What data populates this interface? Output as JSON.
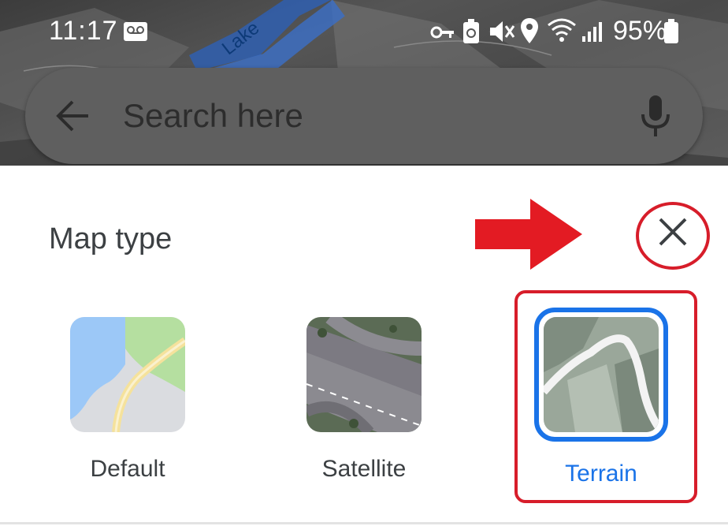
{
  "status_bar": {
    "time": "11:17",
    "battery_percent": "95%",
    "icons": [
      "voicemail-icon",
      "vpn-key-icon",
      "battery-saver-icon",
      "mute-icon",
      "location-icon",
      "wifi-icon",
      "signal-icon",
      "battery-icon"
    ]
  },
  "map": {
    "label": "Lake"
  },
  "search": {
    "placeholder": "Search here",
    "value": ""
  },
  "sheet": {
    "title": "Map type",
    "options": [
      {
        "label": "Default",
        "selected": false,
        "icon": "default-map-thumbnail"
      },
      {
        "label": "Satellite",
        "selected": false,
        "icon": "satellite-map-thumbnail"
      },
      {
        "label": "Terrain",
        "selected": true,
        "icon": "terrain-map-thumbnail"
      }
    ]
  },
  "colors": {
    "accent": "#1a73e8",
    "annotation_red": "#d71d2a",
    "text": "#3c4043"
  }
}
